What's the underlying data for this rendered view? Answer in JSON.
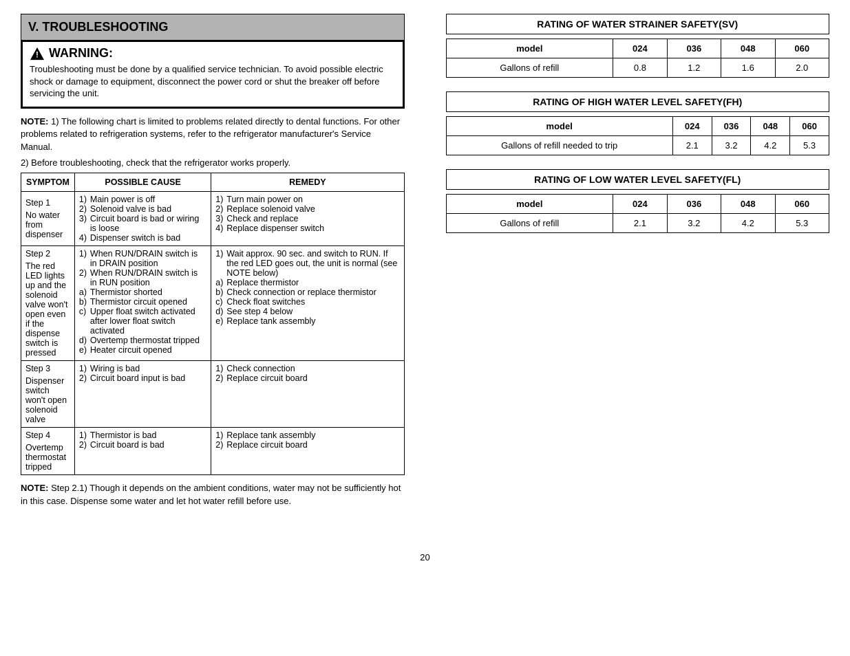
{
  "left": {
    "section_title": "V.   TROUBLESHOOTING",
    "warning_label": "WARNING:",
    "warning_body": "Troubleshooting must be done by a qualified service technician. To avoid possible electric shock or damage to equipment, disconnect the power cord or shut the breaker off before servicing the unit.",
    "note_label": "NOTE:",
    "notes": [
      "1) The following chart is limited to problems related directly to dental functions. For other problems related to refrigeration systems, refer to the refrigerator manufacturer's Service Manual.",
      "2) Before troubleshooting, check that the refrigerator works properly."
    ],
    "table": {
      "headers": [
        "SYMPTOM",
        "POSSIBLE CAUSE",
        "REMEDY"
      ],
      "rows": [
        {
          "step_no": "1",
          "symptom": "No water from dispenser",
          "causes": [
            {
              "n": "1)",
              "text": "Main power is off"
            },
            {
              "n": "2)",
              "text": "Solenoid valve is bad"
            },
            {
              "n": "3)",
              "text": "Circuit board is bad or wiring is loose"
            },
            {
              "n": "4)",
              "text": "Dispenser switch is bad"
            }
          ],
          "remedies": [
            {
              "n": "1)",
              "text": "Turn main power on"
            },
            {
              "n": "2)",
              "text": "Replace solenoid valve"
            },
            {
              "n": "3)",
              "text": "Check and replace"
            },
            {
              "n": "4)",
              "text": "Replace dispenser switch"
            }
          ]
        },
        {
          "step_no": "2",
          "symptom": "The red LED lights up and the solenoid valve won't open even if the dispense switch is pressed",
          "causes": [
            {
              "n": "1)",
              "text": "When RUN/DRAIN switch is in DRAIN position"
            },
            {
              "n": "",
              "text": ""
            },
            {
              "n": "2)",
              "text": "When RUN/DRAIN switch is in RUN position"
            },
            {
              "n": "a)",
              "text": "Thermistor shorted"
            },
            {
              "n": "b)",
              "text": "Thermistor circuit opened"
            },
            {
              "n": "c)",
              "text": "Upper float switch activated after lower float switch activated"
            },
            {
              "n": "d)",
              "text": "Overtemp thermostat tripped"
            },
            {
              "n": "e)",
              "text": "Heater circuit opened"
            }
          ],
          "remedies": [
            {
              "n": "1)",
              "text": "Wait approx. 90 sec. and switch to RUN. If the red LED goes out, the unit is normal (see NOTE below)"
            },
            {
              "n": "",
              "text": ""
            },
            {
              "n": "a)",
              "text": "Replace thermistor"
            },
            {
              "n": "b)",
              "text": "Check connection or replace thermistor"
            },
            {
              "n": "c)",
              "text": "Check float switches"
            },
            {
              "n": "d)",
              "text": "See step 4 below"
            },
            {
              "n": "e)",
              "text": "Replace tank assembly"
            }
          ]
        },
        {
          "step_no": "3",
          "symptom": "Dispenser switch won't open solenoid valve",
          "causes": [
            {
              "n": "1)",
              "text": "Wiring is bad"
            },
            {
              "n": "2)",
              "text": "Circuit board input is bad"
            }
          ],
          "remedies": [
            {
              "n": "1)",
              "text": "Check connection"
            },
            {
              "n": "2)",
              "text": "Replace circuit board"
            }
          ]
        },
        {
          "step_no": "4",
          "symptom": "Overtemp thermostat tripped",
          "causes": [
            {
              "n": "1)",
              "text": "Thermistor is bad"
            },
            {
              "n": "2)",
              "text": "Circuit board is bad"
            }
          ],
          "remedies": [
            {
              "n": "1)",
              "text": "Replace tank assembly"
            },
            {
              "n": "2)",
              "text": "Replace circuit board"
            }
          ]
        }
      ]
    },
    "post_note_label": "NOTE:",
    "post_note": "Step 2.1) Though it depends on the ambient conditions, water may not be sufficiently hot in this case. Dispense some water and let hot water refill before use."
  },
  "right": {
    "blocks": [
      {
        "title": "RATING OF WATER STRAINER SAFETY(SV)",
        "headers": [
          "model",
          "024",
          "036",
          "048",
          "060"
        ],
        "row_label": "Gallons of refill",
        "values": [
          "0.8",
          "1.2",
          "1.6",
          "2.0"
        ]
      },
      {
        "title": "RATING OF HIGH WATER LEVEL SAFETY(FH)",
        "headers": [
          "model",
          "024",
          "036",
          "048",
          "060"
        ],
        "row_label": "Gallons of refill needed to trip",
        "values": [
          "2.1",
          "3.2",
          "4.2",
          "5.3"
        ]
      },
      {
        "title": "RATING OF LOW WATER LEVEL SAFETY(FL)",
        "headers": [
          "model",
          "024",
          "036",
          "048",
          "060"
        ],
        "row_label": "Gallons of refill",
        "values": [
          "2.1",
          "3.2",
          "4.2",
          "5.3"
        ]
      }
    ]
  },
  "page_number": "20"
}
